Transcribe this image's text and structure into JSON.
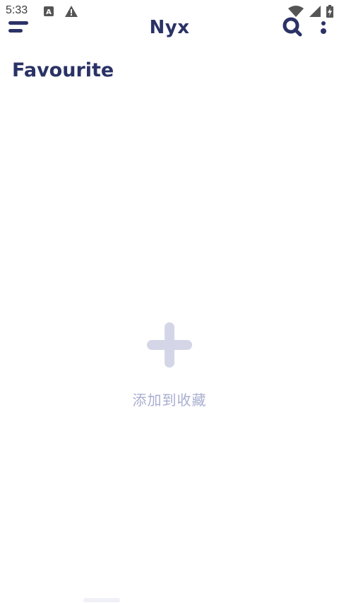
{
  "status_bar": {
    "time": "5:33"
  },
  "app_bar": {
    "title": "Nyx"
  },
  "page": {
    "title": "Favourite"
  },
  "empty_state": {
    "label": "添加到收藏"
  },
  "colors": {
    "primary": "#2a3266",
    "empty_icon": "#d4d6e8",
    "empty_text": "#a9aed0"
  },
  "icons": {
    "menu": "menu-icon",
    "search": "search-icon",
    "more": "more-vert-icon",
    "add": "add-icon",
    "wifi": "wifi-icon",
    "signal": "cell-signal-icon",
    "battery": "battery-charging-icon",
    "notification_a": "a-notification-icon",
    "warning": "warning-icon"
  }
}
